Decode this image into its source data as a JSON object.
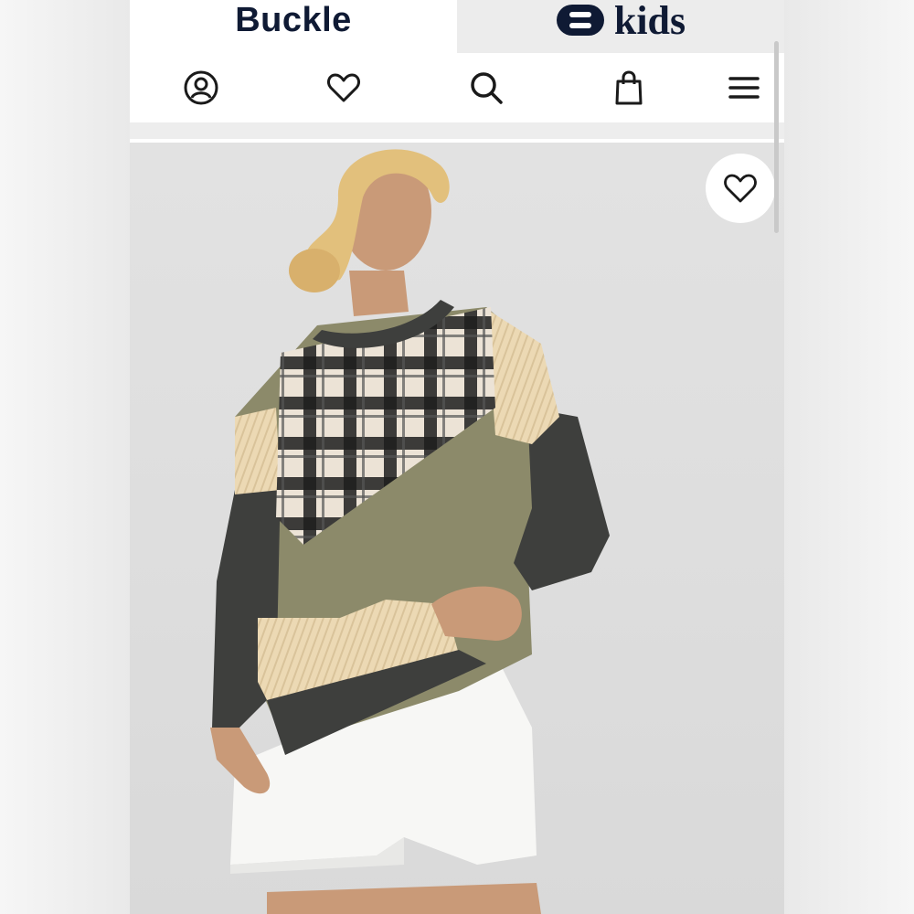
{
  "brands": {
    "buckle": "Buckle",
    "kids": "kids"
  },
  "nav": {
    "icons": [
      "account-icon",
      "heart-icon",
      "search-icon",
      "bag-icon",
      "menu-icon"
    ]
  },
  "product": {
    "image": "model-in-plaid-patchwork-sweatshirt",
    "favorite_icon": "heart-icon"
  },
  "colors": {
    "brand_navy": "#0f1a34",
    "icon": "#1a1a1a",
    "sweater_olive": "#8c8a6a",
    "sweater_charcoal": "#3e3f3d",
    "sweater_cream": "#ecd9b4"
  }
}
